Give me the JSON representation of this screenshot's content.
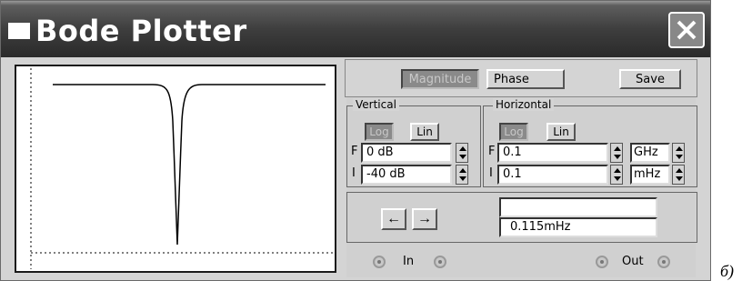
{
  "window": {
    "title": "Bode Plotter",
    "close_icon": "close-x-icon"
  },
  "mode_buttons": {
    "magnitude": "Magnitude",
    "phase": "Phase",
    "save": "Save"
  },
  "vertical": {
    "label": "Vertical",
    "log": "Log",
    "lin": "Lin",
    "f_letter": "F",
    "final": "0 dB",
    "i_letter": "I",
    "initial": "-40 dB"
  },
  "horizontal": {
    "label": "Horizontal",
    "log": "Log",
    "lin": "Lin",
    "f_letter": "F",
    "final": "0.1",
    "final_unit": "GHz",
    "i_letter": "I",
    "initial": "0.1",
    "initial_unit": "mHz"
  },
  "readout": {
    "top_value": "",
    "bottom_value": "0.115mHz",
    "left_arrow": "←",
    "right_arrow": "→"
  },
  "terminals": {
    "in_label": "In",
    "out_label": "Out"
  },
  "caption": "б)",
  "colors": {
    "titlebar": "#3a3a3a",
    "panel": "#d4d4d4",
    "active_button": "#8a8a8a"
  }
}
